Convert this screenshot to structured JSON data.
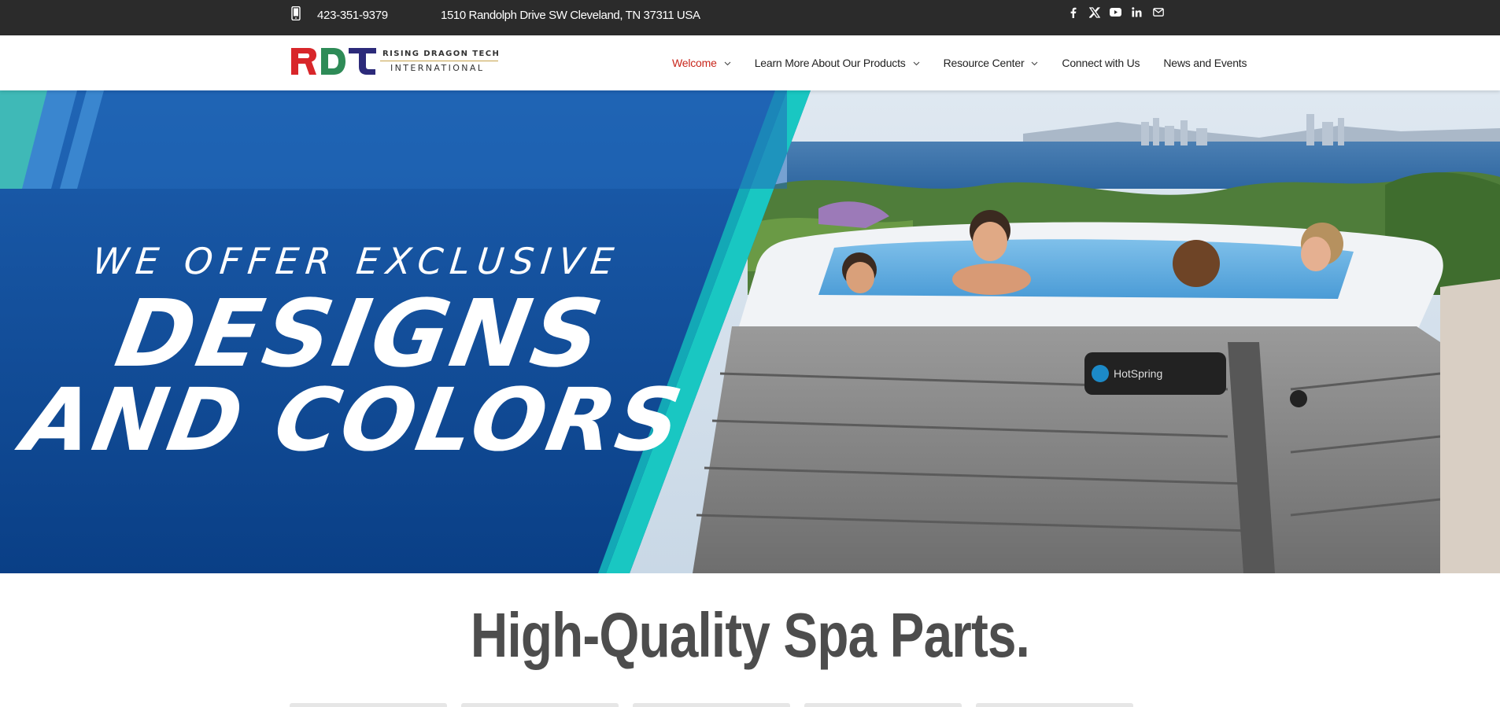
{
  "topbar": {
    "phone_icon": "mobile-phone-icon",
    "phone": "423-351-9379",
    "address": "1510 Randolph Drive SW Cleveland, TN 37311 USA",
    "social": [
      "facebook-icon",
      "x-twitter-icon",
      "youtube-icon",
      "linkedin-icon",
      "email-icon"
    ]
  },
  "logo": {
    "mark": "RDT",
    "top_text": "RISING DRAGON TECH",
    "bottom_text": "INTERNATIONAL",
    "colors": {
      "r": "#d8262a",
      "d": "#2e8b57",
      "t": "#2c2a7a"
    }
  },
  "nav": {
    "items": [
      {
        "label": "Welcome",
        "has_dropdown": true,
        "active": true
      },
      {
        "label": "Learn More About Our Products",
        "has_dropdown": true,
        "active": false
      },
      {
        "label": "Resource Center",
        "has_dropdown": true,
        "active": false
      },
      {
        "label": "Connect with Us",
        "has_dropdown": false,
        "active": false
      },
      {
        "label": "News and Events",
        "has_dropdown": false,
        "active": false
      }
    ],
    "active_color": "#c8261b"
  },
  "hero": {
    "line1": "WE OFFER EXCLUSIVE",
    "line2": "DESIGNS",
    "line3": "AND COLORS",
    "brand_badge": "HotSpring",
    "colors": {
      "blue": "#1456a8",
      "teal": "#19c7c2"
    }
  },
  "section": {
    "title": "High-Quality Spa Parts."
  }
}
